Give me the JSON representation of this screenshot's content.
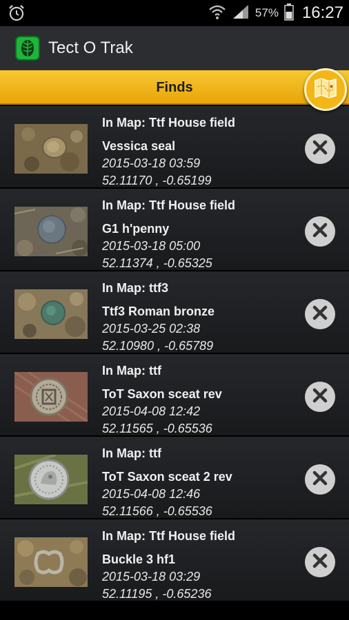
{
  "status_bar": {
    "battery_percent": "57%",
    "time": "16:27",
    "icons": [
      "alarm-clock-icon",
      "wifi-icon",
      "signal-icon",
      "battery-icon"
    ]
  },
  "app": {
    "title": "Tect O Trak",
    "logo": "leaf-logo-icon"
  },
  "finds_header": {
    "title": "Finds",
    "map_button_icon": "map-icon"
  },
  "finds": [
    {
      "map": "In Map: Ttf House field",
      "name": "Vessica seal",
      "date": "2015-03-18 03:59",
      "coords": "52.11170 , -0.65199",
      "thumb": "seal"
    },
    {
      "map": "In Map: Ttf House field",
      "name": "G1 h'penny",
      "date": "2015-03-18 05:00",
      "coords": "52.11374 , -0.65325",
      "thumb": "coin-grey"
    },
    {
      "map": "In Map: ttf3",
      "name": "Ttf3 Roman bronze",
      "date": "2015-03-25 02:38",
      "coords": "52.10980 , -0.65789",
      "thumb": "coin-green"
    },
    {
      "map": "In Map: ttf",
      "name": "ToT Saxon sceat  rev",
      "date": "2015-04-08 12:42",
      "coords": "52.11565 , -0.65536",
      "thumb": "sceat-rev"
    },
    {
      "map": "In Map: ttf",
      "name": "ToT Saxon sceat  2 rev",
      "date": "2015-04-08 12:46",
      "coords": "52.11566 , -0.65536",
      "thumb": "sceat-2"
    },
    {
      "map": "In Map: Ttf House field",
      "name": "Buckle 3 hf1",
      "date": "2015-03-18 03:29",
      "coords": "52.11195 , -0.65236",
      "thumb": "buckle"
    }
  ],
  "colors": {
    "accent": "#f4b616",
    "row_bg": "#212326",
    "app_bar": "#2b2d30",
    "logo_green": "#1fb43c"
  }
}
